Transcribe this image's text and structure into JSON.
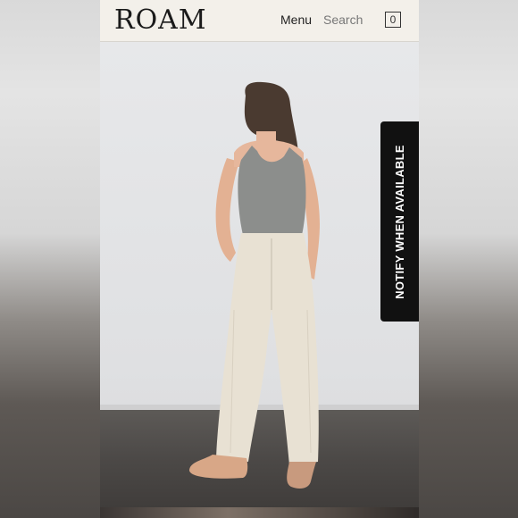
{
  "header": {
    "logo": "ROAM",
    "menu_label": "Menu",
    "search_label": "Search",
    "cart_count": "0"
  },
  "product": {
    "image_description": "model-wearing-cream-pants",
    "notify_label": "NOTIFY WHEN AVAILABLE"
  },
  "colors": {
    "header_bg": "#f3f0ea",
    "notify_bg": "#111111",
    "pants": "#e8e1d3",
    "tank_top": "#8c8e8c"
  }
}
